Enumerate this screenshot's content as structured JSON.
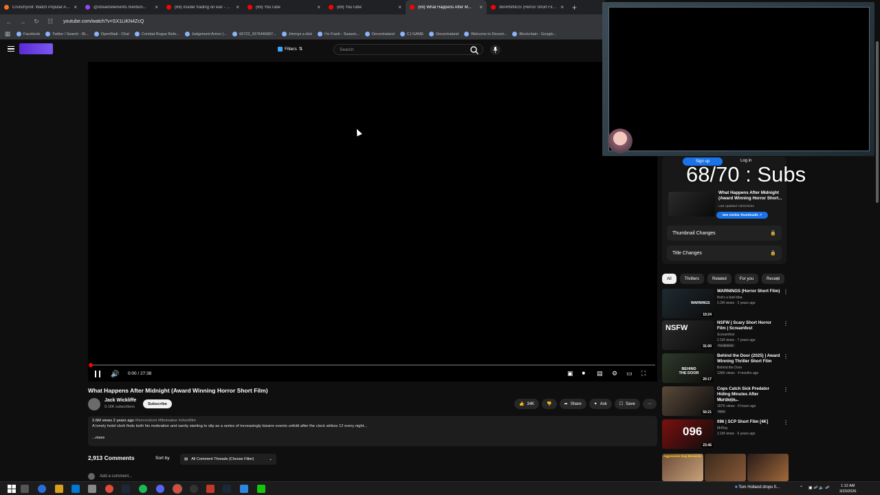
{
  "browser": {
    "tabs": [
      {
        "label": "Crunchyroll: Watch Popular Ani...",
        "color": "#f47521"
      },
      {
        "label": "@streamelements mention...",
        "color": "#9146ff"
      },
      {
        "label": "(69) insider trading on war - Yo...",
        "color": "#ff0000"
      },
      {
        "label": "(69) YouTube",
        "color": "#ff0000"
      },
      {
        "label": "(69) YouTube",
        "color": "#ff0000"
      },
      {
        "label": "(69) What Happens After M...",
        "color": "#ff0000"
      },
      {
        "label": "WARNINGS (Horror Short Film)",
        "color": "#ff0000"
      }
    ],
    "url": "youtube.com/watch?v=SX1LiKN4ZcQ",
    "bookmarks": [
      "Facebook",
      "Twitter / Search - Bi...",
      "OpenRadi - Chat",
      "Combat Rogue Refo...",
      "Judgement Armor (...",
      "66722_3376446997...",
      "Jimmys a dick",
      "I'm Frank - Season...",
      "Decentraland",
      "CJ GAME",
      "Decentraland",
      "Welcome to Decent...",
      "Blockchain - Google..."
    ]
  },
  "header": {
    "filters_label": "Filters",
    "search_placeholder": "Search"
  },
  "player": {
    "time": "0:00 / 27:38",
    "progress_fraction": 0.0
  },
  "video": {
    "title": "What Happens After Midnight (Award Winning Horror Short Film)",
    "channel": "Jack Wickliffe",
    "subscribers": "9.16K subscribers",
    "subscribe_label": "Subscribe",
    "likes": "34K",
    "share_label": "Share",
    "ask_label": "Ask",
    "save_label": "Save",
    "views_age": "2.6M views  2 years ago",
    "tags": "#horrorshort #filmmaker #shortfilm",
    "description": "A lonely hotel clerk finds both his motivation and sanity starting to slip as a series of increasingly bizarre events unfold after the clock strikes 12 every night...",
    "more_label": "...more"
  },
  "comments": {
    "count": "2,913 Comments",
    "sort_label": "Sort by",
    "filter_label": "All Comment Threads (Choose Filter)",
    "add_placeholder": "Add a comment..."
  },
  "extension": {
    "signup_label": "Sign up",
    "login_label": "Log in",
    "subs_counter": "68/70 : Subs",
    "card_title": "What Happens After Midnight (Award Winning Horror Short...",
    "last_updated": "Last Updated: 03/22/2024",
    "similar_label": "See similar thumbnails ↗",
    "thumbnail_changes": "Thumbnail Changes",
    "title_changes": "Title Changes"
  },
  "chips": [
    "All",
    "Thrillers",
    "Related",
    "For you",
    "Recent"
  ],
  "recommendations": [
    {
      "title": "WARNINGS (Horror Short Film)",
      "channel": "that's a bad idea",
      "stats": "2.2M views · 2 years ago",
      "duration": "19:24",
      "thumb_text": "WARNINGS",
      "color": "#1f2b30"
    },
    {
      "title": "NSFW | Scary Short Horror Film | Screamfest",
      "channel": "Screamfest",
      "stats": "2.1M views · 7 years ago",
      "duration": "31:00",
      "badge": "Fundraiser",
      "thumb_text": "NSFW",
      "color": "#2a2a2a"
    },
    {
      "title": "Behind the Door (2025) | Award Winning Thriller Short Film",
      "channel": "Behind the Door",
      "stats": "136K views · 4 months ago",
      "duration": "20:17",
      "thumb_text": "BEHIND THE DOOR",
      "color": "#2e3a2a"
    },
    {
      "title": "Cops Catch Sick Predator Hiding Minutes After Murderin...",
      "channel": "That Chapter",
      "stats": "187K views · 9 hours ago",
      "duration": "50:21",
      "badge": "New",
      "thumb_text": "",
      "color": "#5a4a3a"
    },
    {
      "title": "096 | SCP Short Film [4K]",
      "channel": "MrKlay",
      "stats": "2.1M views · 6 years ago",
      "duration": "23:46",
      "thumb_text": "096",
      "color": "#7a1010"
    }
  ],
  "bottom_thumb_label": "Aggressive Dog Moments",
  "taskbar": {
    "notification": "Tom Holland drops fi...",
    "time": "1:12 AM",
    "date": "3/23/2026"
  }
}
